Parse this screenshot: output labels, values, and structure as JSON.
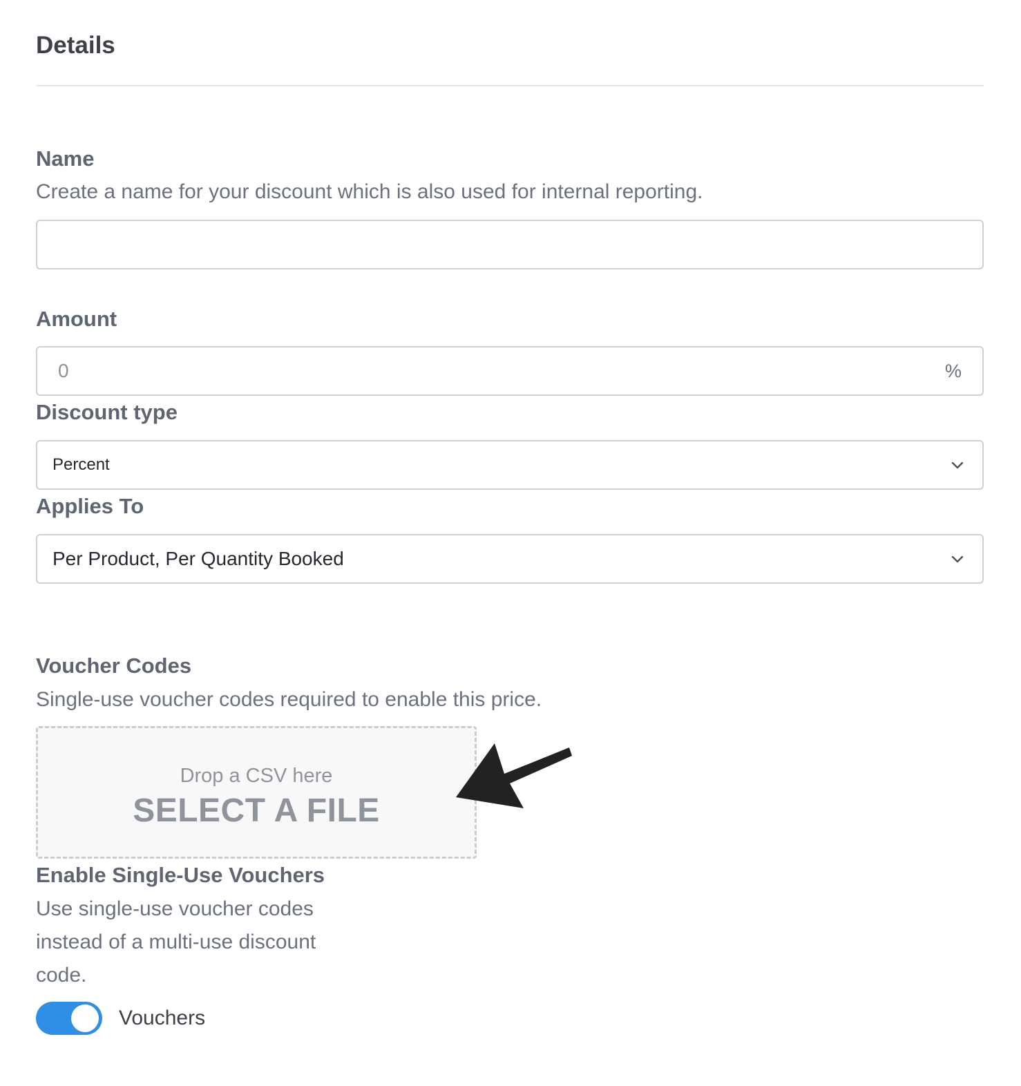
{
  "details": {
    "title": "Details"
  },
  "name": {
    "label": "Name",
    "help": "Create a name for your discount which is also used for internal reporting.",
    "value": "",
    "placeholder": ""
  },
  "amount": {
    "label": "Amount",
    "value": "",
    "placeholder": "0",
    "suffix": "%"
  },
  "discount_type": {
    "label": "Discount type",
    "selected": "Percent",
    "icon": "chevron-down-icon"
  },
  "applies_to": {
    "label": "Applies To",
    "selected": "Per Product, Per Quantity Booked",
    "icon": "chevron-down-icon"
  },
  "voucher_codes": {
    "label": "Voucher Codes",
    "help": "Single-use voucher codes required to enable this price.",
    "drop_hint": "Drop a CSV here",
    "select_label": "SELECT A FILE"
  },
  "single_use": {
    "label": "Enable Single-Use Vouchers",
    "help_lines": [
      "Use single-use voucher codes",
      "instead of a multi-use discount",
      "code."
    ],
    "toggle_label": "Vouchers",
    "enabled": true
  },
  "colors": {
    "toggle_on": "#2f8ee6",
    "annotation_arrow": "#222222"
  }
}
